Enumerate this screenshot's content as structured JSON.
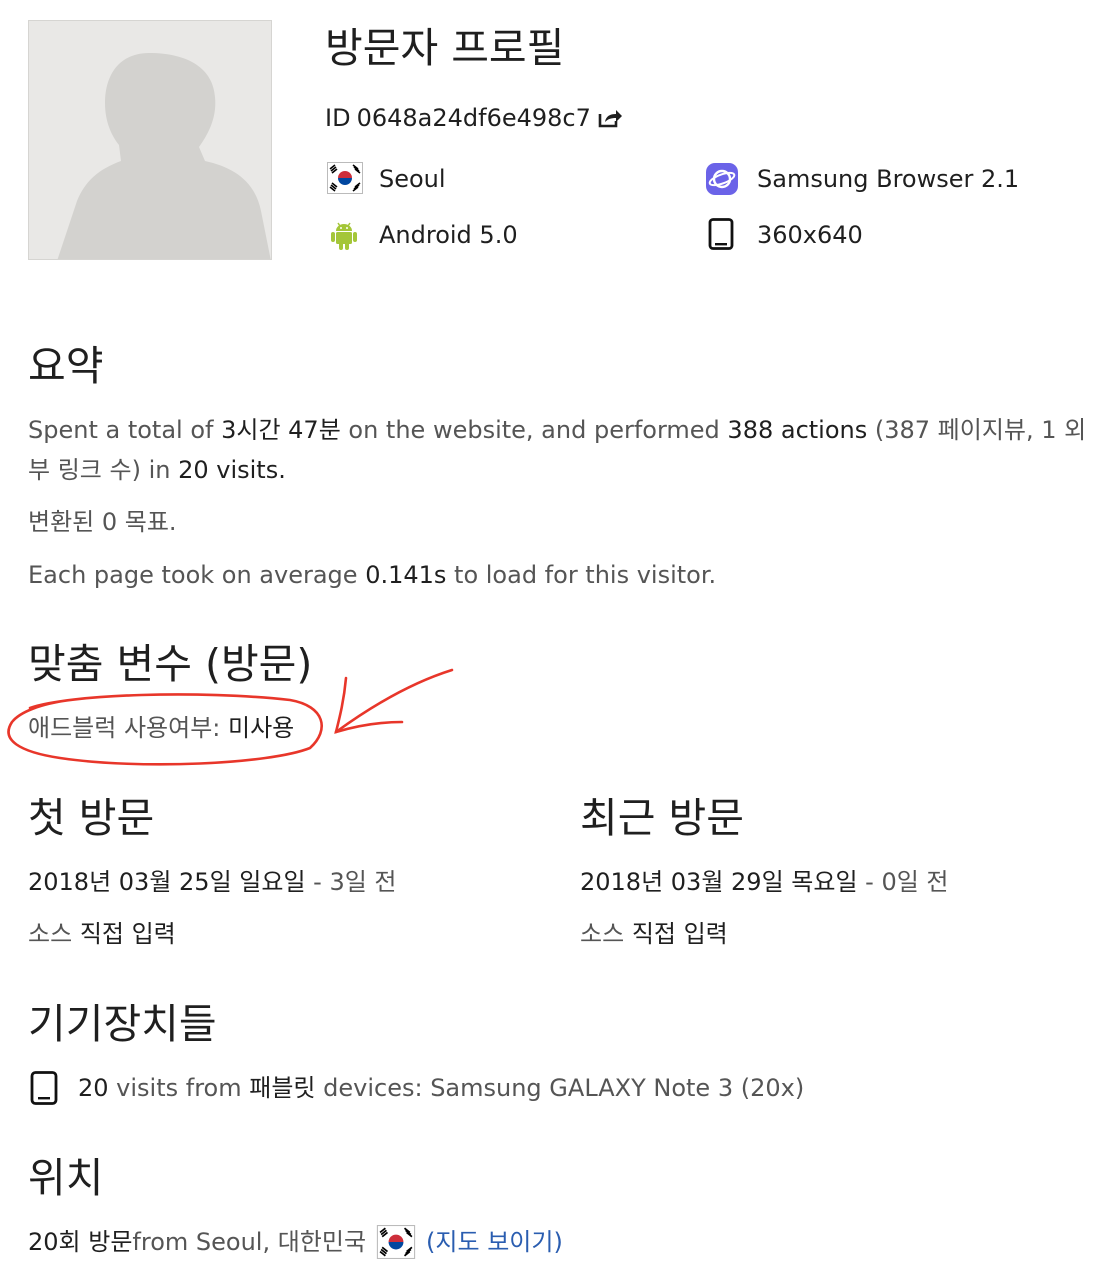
{
  "profile": {
    "title": "방문자 프로필",
    "id_label": "ID",
    "id_value": "0648a24df6e498c7",
    "location": "Seoul",
    "browser": "Samsung Browser 2.1",
    "os": "Android 5.0",
    "resolution": "360x640"
  },
  "summary": {
    "heading": "요약",
    "line1": {
      "pre": "Spent a total of ",
      "time": "3시간 47분",
      "mid": " on the website, and performed ",
      "actions": "388 actions",
      "paren": " (387 페이지뷰, 1 외",
      "paren2": "부 링크 수) in ",
      "visits": "20 visits",
      "end": "."
    },
    "conversions": "변환된 0 목표.",
    "load_pre": "Each page took on average ",
    "load_value": "0.141s",
    "load_post": " to load for this visitor."
  },
  "custom_vars": {
    "heading": "맞춤 변수 (방문)",
    "label": "애드블럭 사용여부:",
    "value": "미사용"
  },
  "first_visit": {
    "heading": "첫 방문",
    "date": "2018년 03월 25일 일요일",
    "sep": " - ",
    "ago": "3일 전",
    "source_label": "소스",
    "source_value": "직접 입력"
  },
  "last_visit": {
    "heading": "최근 방문",
    "date": "2018년 03월 29일 목요일",
    "sep": " - ",
    "ago": "0일 전",
    "source_label": "소스",
    "source_value": "직접 입력"
  },
  "devices": {
    "heading": "기기장치들",
    "count": "20",
    "text1": " visits from ",
    "type": "패블릿",
    "text2": " devices: ",
    "model": "Samsung GALAXY Note 3 (20x)"
  },
  "location_section": {
    "heading": "위치",
    "count": "20회 방문",
    "from": " from Seoul, 대한민국",
    "map_link": "(지도 보이기)"
  },
  "colors": {
    "annotation": "#e8362a",
    "link": "#2a5db0",
    "android": "#a4c639",
    "samsung_browser": "#6b63e8"
  },
  "icons": [
    "person-silhouette-icon",
    "external-link-icon",
    "korea-flag-icon",
    "samsung-browser-icon",
    "android-icon",
    "tablet-icon"
  ]
}
